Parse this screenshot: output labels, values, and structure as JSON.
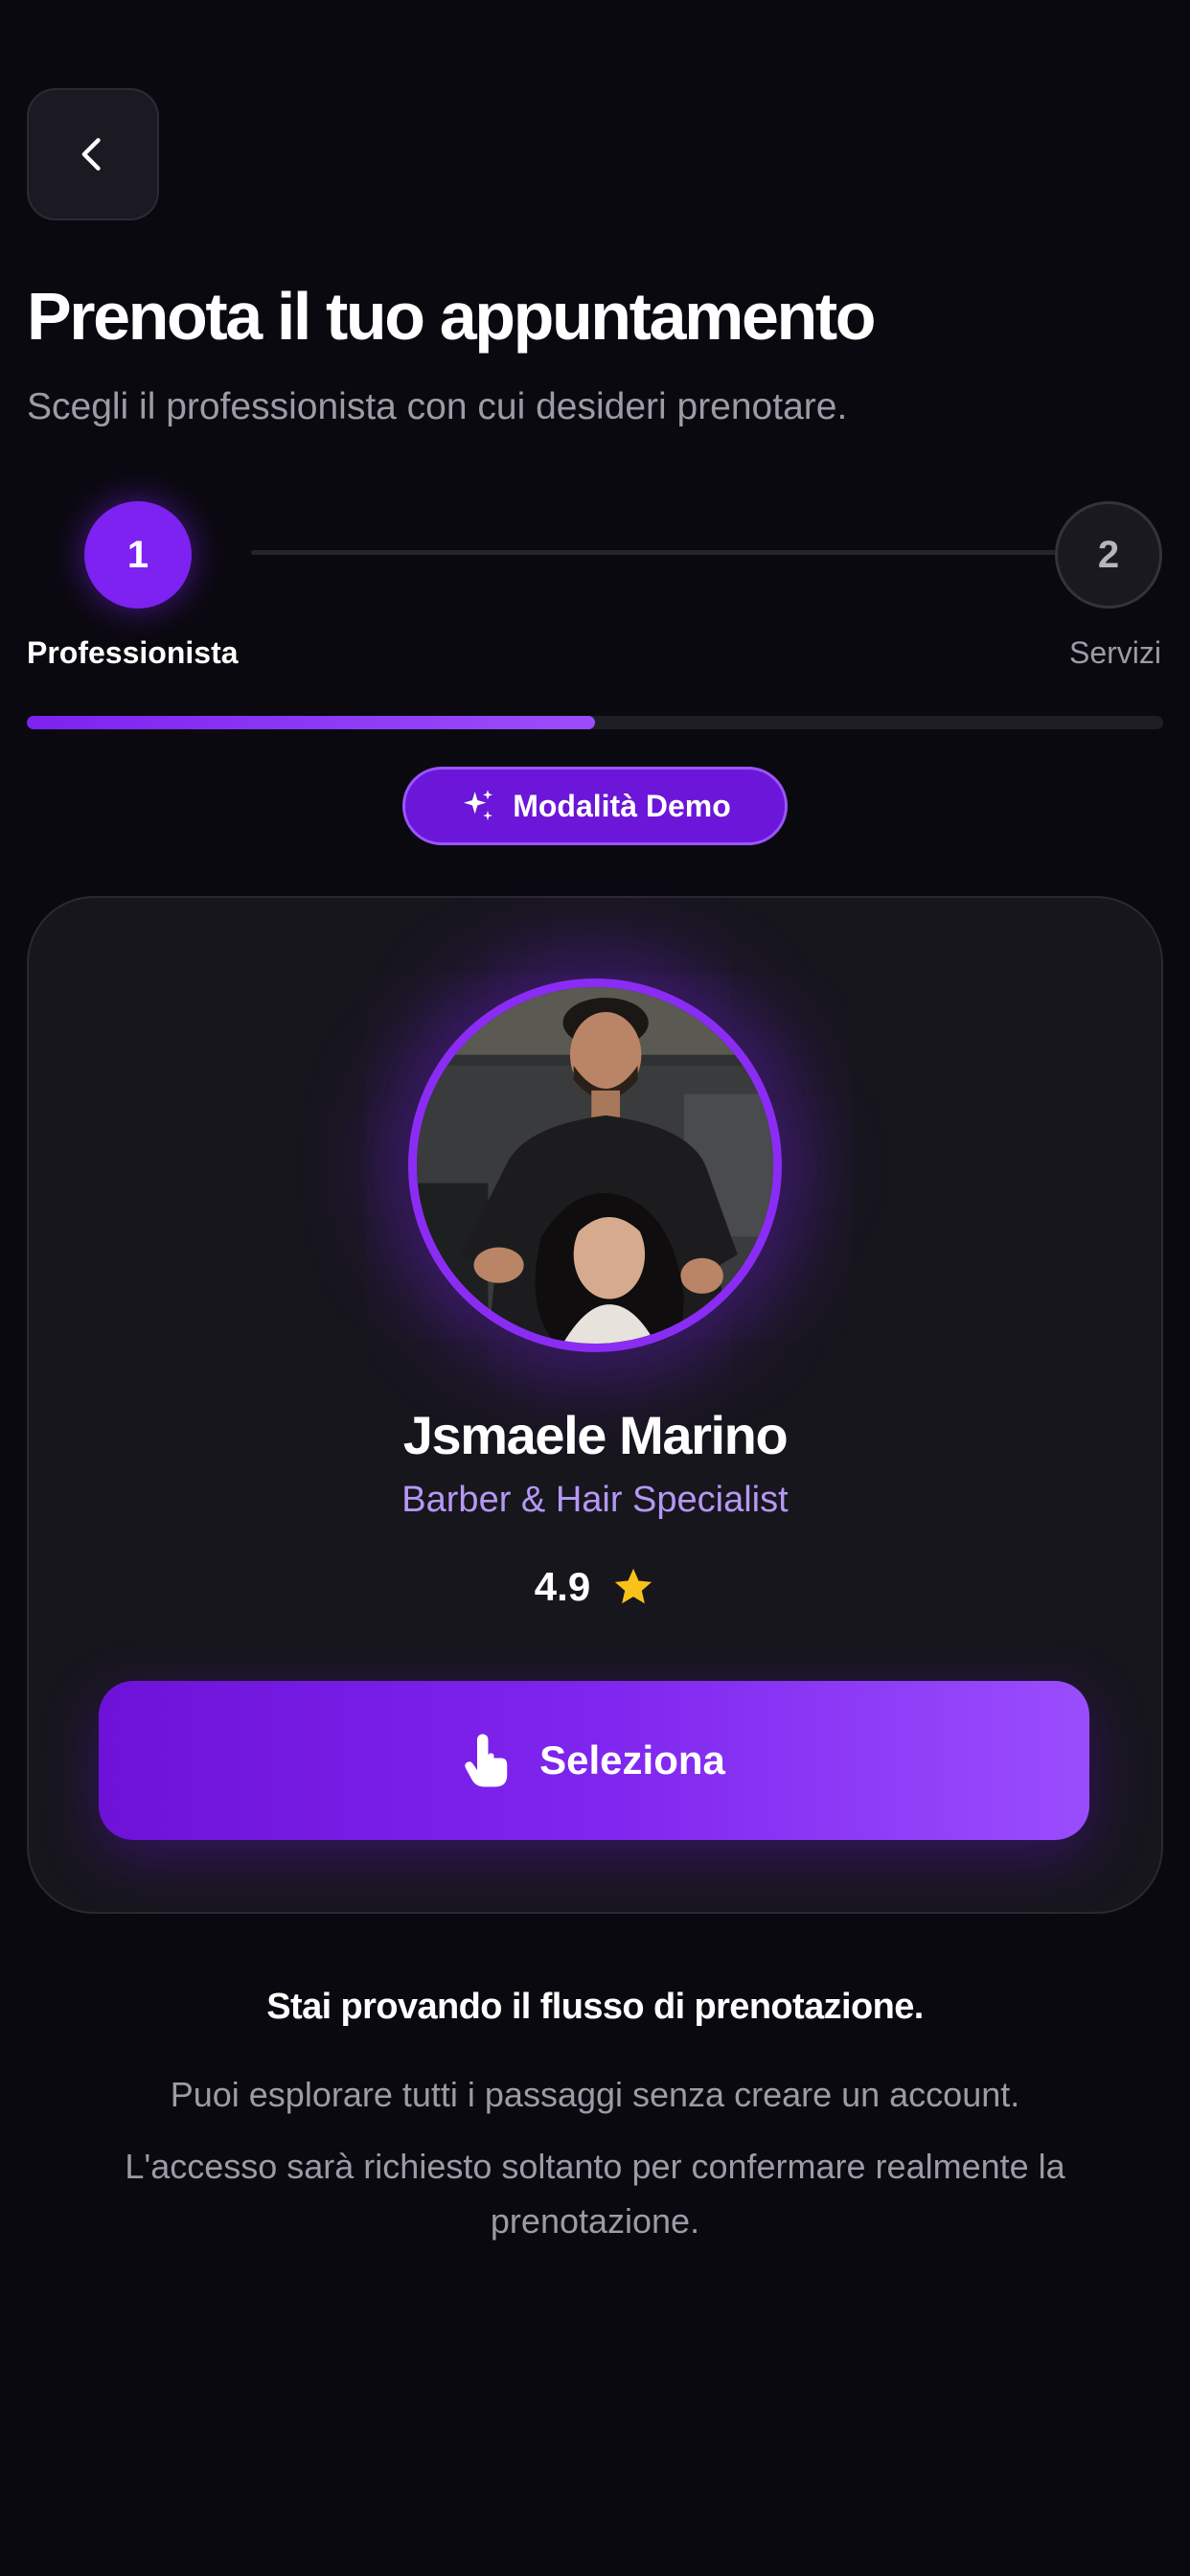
{
  "header": {
    "back_icon": "chevron-left-icon",
    "title": "Prenota il tuo appuntamento",
    "subtitle": "Scegli il professionista con cui desideri prenotare."
  },
  "stepper": {
    "steps": [
      {
        "number": "1",
        "label": "Professionista",
        "active": true
      },
      {
        "number": "2",
        "label": "Servizi",
        "active": false
      }
    ],
    "progress": 0.5
  },
  "demo_badge": {
    "icon": "sparkles-icon",
    "label": "Modalità Demo"
  },
  "professional": {
    "name": "Jsmaele Marino",
    "role": "Barber & Hair Specialist",
    "rating": "4.9",
    "rating_icon": "star-icon",
    "select_label": "Seleziona",
    "select_icon": "hand-pointer-icon"
  },
  "info": {
    "title": "Stai provando il flusso di prenotazione.",
    "line1": "Puoi esplorare tutti i passaggi senza creare un account.",
    "line2": "L'accesso sarà richiesto soltanto per confermare realmente la prenotazione."
  },
  "colors": {
    "background": "#0a090f",
    "accent": "#7d22f0",
    "card": "#17161d",
    "role_text": "#b598f4",
    "star": "#f8c21a"
  }
}
